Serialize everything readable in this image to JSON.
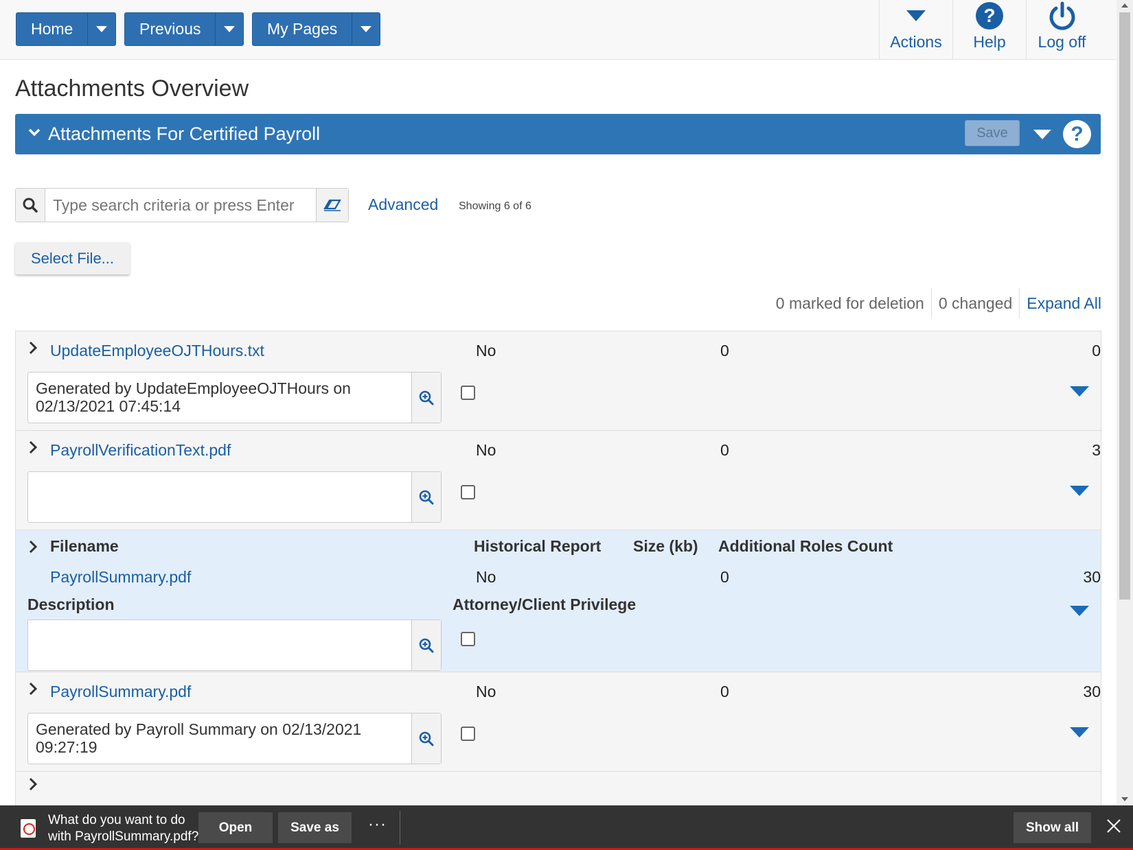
{
  "nav": {
    "home": "Home",
    "previous": "Previous",
    "my_pages": "My Pages",
    "actions": "Actions",
    "help": "Help",
    "log_off": "Log off"
  },
  "page": {
    "title": "Attachments Overview"
  },
  "panel": {
    "title": "Attachments For Certified Payroll",
    "save": "Save"
  },
  "search": {
    "placeholder": "Type search criteria or press Enter",
    "advanced": "Advanced",
    "showing": "Showing 6 of 6"
  },
  "select_file": "Select File...",
  "status": {
    "marked": "0 marked for deletion",
    "changed": "0 changed",
    "expand_all": "Expand All"
  },
  "headers": {
    "filename": "Filename",
    "historical": "Historical Report",
    "size": "Size (kb)",
    "roles": "Additional Roles Count",
    "description": "Description",
    "privilege": "Attorney/Client Privilege"
  },
  "rows": [
    {
      "filename": "UpdateEmployeeOJTHours.txt",
      "historical": "No",
      "size": "0",
      "roles": "0",
      "description": "Generated by UpdateEmployeeOJTHours on 02/13/2021 07:45:14",
      "privilege": false
    },
    {
      "filename": "PayrollVerificationText.pdf",
      "historical": "No",
      "size": "3",
      "roles": "0",
      "description": "",
      "privilege": false
    },
    {
      "filename": "PayrollSummary.pdf",
      "historical": "No",
      "size": "30",
      "roles": "0",
      "description": "",
      "privilege": false
    },
    {
      "filename": "PayrollSummary.pdf",
      "historical": "No",
      "size": "30",
      "roles": "0",
      "description": "Generated by Payroll Summary on 02/13/2021 09:27:19",
      "privilege": false
    }
  ],
  "download": {
    "message_line1": "What do you want to do",
    "message_line2": "with PayrollSummary.pdf?",
    "open": "Open",
    "save_as": "Save as",
    "more": "···",
    "show_all": "Show all"
  },
  "colors": {
    "primary": "#2e75b6",
    "link": "#1a5fa4",
    "active_row": "#e3eefb"
  }
}
